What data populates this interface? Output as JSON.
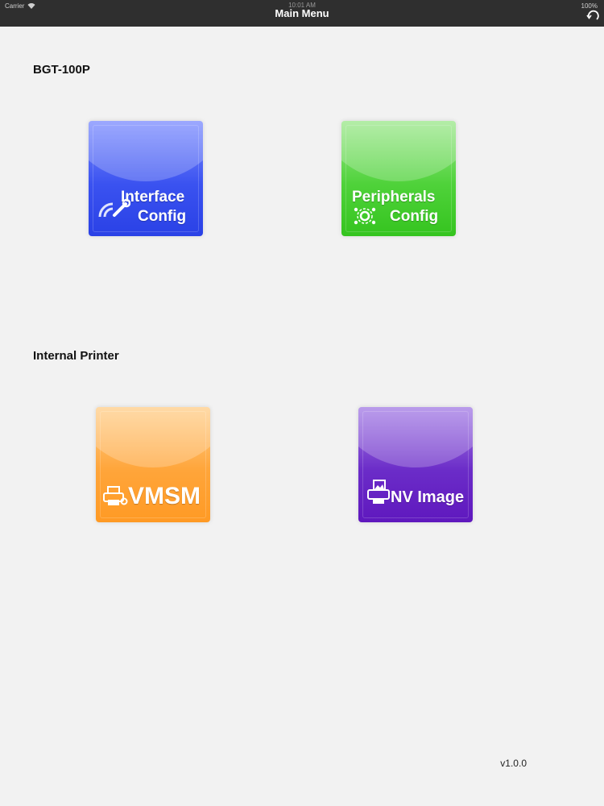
{
  "status_bar": {
    "carrier": "Carrier",
    "time": "10:01 AM",
    "battery": "100%"
  },
  "nav": {
    "title": "Main Menu",
    "right_icon": "refresh-icon"
  },
  "sections": [
    {
      "title": "BGT-100P",
      "tiles": [
        {
          "line1": "Interface",
          "line2": "Config",
          "icon": "wifi-wrench-icon",
          "color": "#3a52f0"
        },
        {
          "line1": "Peripherals",
          "line2": "Config",
          "icon": "gear-network-icon",
          "color": "#4fd23a"
        }
      ]
    },
    {
      "title": "Internal Printer",
      "tiles": [
        {
          "label": "VMSM",
          "icon": "printer-gear-icon",
          "color": "#ffa53a"
        },
        {
          "label": "NV Image",
          "icon": "printer-image-icon",
          "color": "#6b2cc8"
        }
      ]
    }
  ],
  "footer": {
    "version": "v1.0.0"
  }
}
